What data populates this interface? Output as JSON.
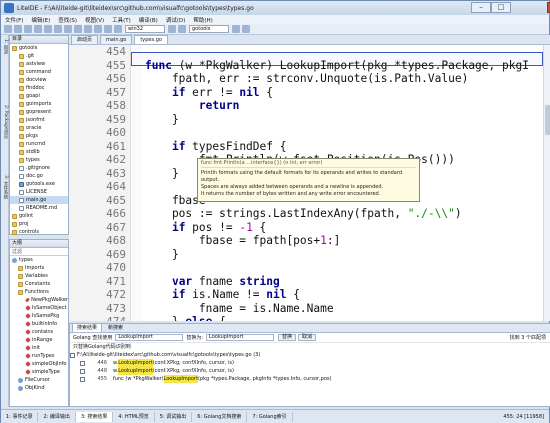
{
  "window": {
    "title": "LiteIDE - F:\\Ai\\liteide-git\\liteidex\\src\\github.com\\visualfc\\gotools\\types\\types.go"
  },
  "menu": [
    "文件(F)",
    "编辑(E)",
    "查找(S)",
    "视图(V)",
    "工具(T)",
    "编译(B)",
    "调试(D)",
    "帮助(H)"
  ],
  "toolbar": {
    "env": "win32",
    "build": "gotools"
  },
  "left_sidebar": [
    "1: 目录",
    "2: Package浏览",
    "3: 文件系统"
  ],
  "folders": {
    "title": "目录",
    "items": [
      {
        "label": "gotools",
        "kind": "fold"
      },
      {
        "label": ".git",
        "kind": "fold"
      },
      {
        "label": "astview",
        "kind": "fold"
      },
      {
        "label": "command",
        "kind": "fold"
      },
      {
        "label": "docview",
        "kind": "fold"
      },
      {
        "label": "finddoc",
        "kind": "fold"
      },
      {
        "label": "goapi",
        "kind": "fold"
      },
      {
        "label": "goimports",
        "kind": "fold"
      },
      {
        "label": "gopresent",
        "kind": "fold"
      },
      {
        "label": "jsonfmt",
        "kind": "fold"
      },
      {
        "label": "oracle",
        "kind": "fold"
      },
      {
        "label": "pkgs",
        "kind": "fold"
      },
      {
        "label": "runcmd",
        "kind": "fold"
      },
      {
        "label": "stdlib",
        "kind": "fold"
      },
      {
        "label": "types",
        "kind": "fold"
      },
      {
        "label": ".gitignore",
        "kind": "file"
      },
      {
        "label": "doc.go",
        "kind": "file"
      },
      {
        "label": "gotools.exe",
        "kind": "exe"
      },
      {
        "label": "LICENSE",
        "kind": "file"
      },
      {
        "label": "main.go",
        "kind": "file"
      },
      {
        "label": "README.md",
        "kind": "file"
      },
      {
        "label": "golint",
        "kind": "fold"
      },
      {
        "label": "proj",
        "kind": "fold"
      },
      {
        "label": "controls",
        "kind": "fold"
      }
    ]
  },
  "outline": {
    "title": "大纲",
    "filter": "过滤",
    "items": [
      {
        "label": "types",
        "kind": "typ"
      },
      {
        "label": "Imports",
        "kind": "fold"
      },
      {
        "label": "Variables",
        "kind": "fold"
      },
      {
        "label": "Constants",
        "kind": "fold"
      },
      {
        "label": "Functions",
        "kind": "fold"
      },
      {
        "label": "NewPkgWalker",
        "kind": "fn"
      },
      {
        "label": "IsSameObject",
        "kind": "fn"
      },
      {
        "label": "IsSamePkg",
        "kind": "fn"
      },
      {
        "label": "builtinInfo",
        "kind": "fn"
      },
      {
        "label": "contains",
        "kind": "fn"
      },
      {
        "label": "inRange",
        "kind": "fn"
      },
      {
        "label": "init",
        "kind": "fn"
      },
      {
        "label": "runTypes",
        "kind": "fn"
      },
      {
        "label": "simpleObjInfo",
        "kind": "fn"
      },
      {
        "label": "simpleType",
        "kind": "fn"
      },
      {
        "label": "FileCursor",
        "kind": "typ"
      },
      {
        "label": "ObjKind",
        "kind": "typ"
      }
    ]
  },
  "editor_tabs": [
    "启动页",
    "main.go",
    "types.go"
  ],
  "code": [
    {
      "n": "454",
      "h": ""
    },
    {
      "n": "455",
      "h": "<span class='kw'>func</span> (w *PkgWalker) LookupImport(pkg *types.Package, pkgI"
    },
    {
      "n": "456",
      "h": "    fpath, err := strconv.Unquote(is.Path.Value)"
    },
    {
      "n": "457",
      "h": "    <span class='kw'>if</span> err != <span class='kw'>nil</span> {"
    },
    {
      "n": "458",
      "h": "        <span class='kw'>return</span>"
    },
    {
      "n": "459",
      "h": "    }"
    },
    {
      "n": "460",
      "h": ""
    },
    {
      "n": "461",
      "h": "    <span class='kw'>if</span> typesFindDef {"
    },
    {
      "n": "462",
      "h": "        fmt.Println(w.fset.Position(is.Pos()))"
    },
    {
      "n": "463",
      "h": "    }"
    },
    {
      "n": "464",
      "h": ""
    },
    {
      "n": "465",
      "h": "    fbase"
    },
    {
      "n": "466",
      "h": "    pos := strings.LastIndexAny(fpath, <span class='str'>\"./-\\\\\"</span>)"
    },
    {
      "n": "467",
      "h": "    <span class='kw'>if</span> pos != <span class='num'>-1</span> {"
    },
    {
      "n": "468",
      "h": "        fbase = fpath[pos+<span class='num'>1</span>:]"
    },
    {
      "n": "469",
      "h": "    }"
    },
    {
      "n": "470",
      "h": ""
    },
    {
      "n": "471",
      "h": "    <span class='kw'>var</span> fname <span class='kw'>string</span>"
    },
    {
      "n": "472",
      "h": "    <span class='kw'>if</span> is.Name != <span class='kw'>nil</span> {"
    },
    {
      "n": "473",
      "h": "        fname = is.Name.Name"
    },
    {
      "n": "474",
      "h": "    } <span class='kw'>else</span> {"
    }
  ],
  "tooltip": {
    "sig": "func fmt.Println(a ...interface{}) (n int, err error)",
    "lines": [
      "Println formats using the default formats for its operands and writes to standard output.",
      "Spaces are always added between operands and a newline is appended.",
      "It returns the number of bytes written and any write error encountered."
    ]
  },
  "bottom": {
    "tabs": [
      "搜索结果",
      "新搜索"
    ],
    "search_label": "Golang 查找使用",
    "search_value": "LookupImport",
    "replace_label": "替换为:",
    "replace_value": "LookupImport",
    "btn_replace": "替换",
    "btn_cancel": "取消",
    "result_summary": "找到 3 个匹配项",
    "options": "只替换Golang代码识别到",
    "file": "F:\\Ai\\liteide-git\\liteidex\\src\\github.com\\visualfc\\gotools\\types\\types.go (3)",
    "results": [
      {
        "line": "446",
        "pre": "w.",
        "hit": "LookupImport",
        "post": "(conf.XPkg, confXInfo, cursor, is)"
      },
      {
        "line": "448",
        "pre": "w.",
        "hit": "LookupImport",
        "post": "(conf.XPkg, confXInfo, cursor, is)"
      },
      {
        "line": "455",
        "pre": "func (w *PkgWalker) ",
        "hit": "LookupImport",
        "post": "(pkg *types.Package, pkgInfo *types.Info, cursor,pos)"
      }
    ]
  },
  "status": {
    "tabs": [
      "1: 事件记录",
      "2: 编译输出",
      "3: 搜索结果",
      "4: HTML预览",
      "5: 调试输出",
      "6: Golang文档搜索",
      "7: Golang索引"
    ],
    "active": 2,
    "pos": "455: 24 [11958]"
  }
}
